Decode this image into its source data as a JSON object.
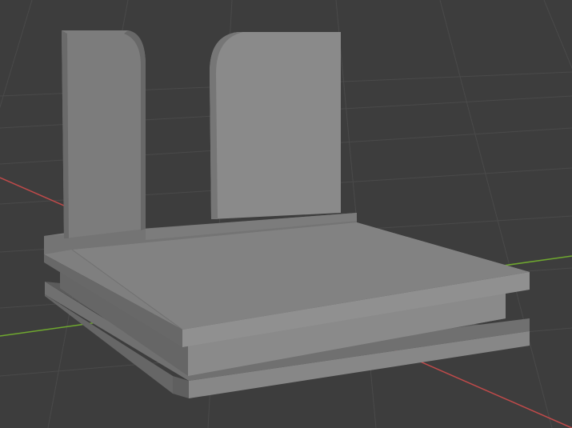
{
  "viewport": {
    "background_color": "#3d3d3d",
    "grid_color": "#4a4a4a",
    "x_axis_color": "#c04a4a",
    "y_axis_color": "#6fa82f",
    "model_face_colors": {
      "top": "#7f7f7f",
      "front": "#8e8e8e",
      "side": "#6a6a6a",
      "shadow": "#5c5c5c"
    }
  }
}
